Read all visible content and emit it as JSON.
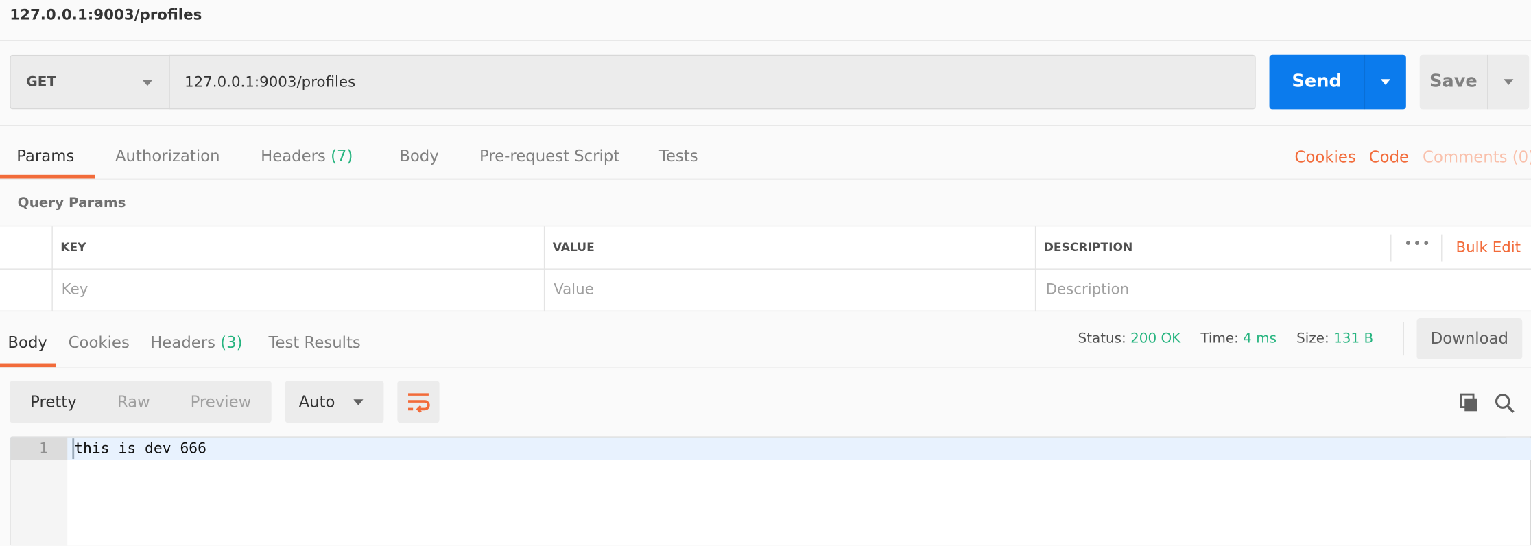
{
  "window": {
    "title": "127.0.0.1:9003/profiles"
  },
  "request": {
    "method": "GET",
    "url": "127.0.0.1:9003/profiles",
    "send_label": "Send",
    "save_label": "Save"
  },
  "request_tabs": [
    {
      "label": "Params",
      "active": true
    },
    {
      "label": "Authorization"
    },
    {
      "label": "Headers",
      "count": "(7)"
    },
    {
      "label": "Body"
    },
    {
      "label": "Pre-request Script"
    },
    {
      "label": "Tests"
    }
  ],
  "request_links": {
    "cookies": "Cookies",
    "code": "Code",
    "comments": "Comments (0)"
  },
  "query_params": {
    "title": "Query Params",
    "columns": [
      "KEY",
      "VALUE",
      "DESCRIPTION"
    ],
    "more": "•••",
    "bulk_edit": "Bulk Edit",
    "placeholders": {
      "key": "Key",
      "value": "Value",
      "description": "Description"
    }
  },
  "response_tabs": [
    {
      "label": "Body",
      "active": true
    },
    {
      "label": "Cookies"
    },
    {
      "label": "Headers",
      "count": "(3)"
    },
    {
      "label": "Test Results"
    }
  ],
  "response_meta": {
    "status_label": "Status:",
    "status": "200 OK",
    "time_label": "Time:",
    "time": "4 ms",
    "size_label": "Size:",
    "size": "131 B",
    "download": "Download"
  },
  "view": {
    "modes": [
      "Pretty",
      "Raw",
      "Preview"
    ],
    "active_mode": "Pretty",
    "format": "Auto"
  },
  "editor": {
    "lines": [
      {
        "number": "1",
        "text": "this is dev 666"
      }
    ]
  },
  "colors": {
    "accent": "#f26b3a",
    "send": "#0b7bed",
    "success": "#26b47f"
  }
}
